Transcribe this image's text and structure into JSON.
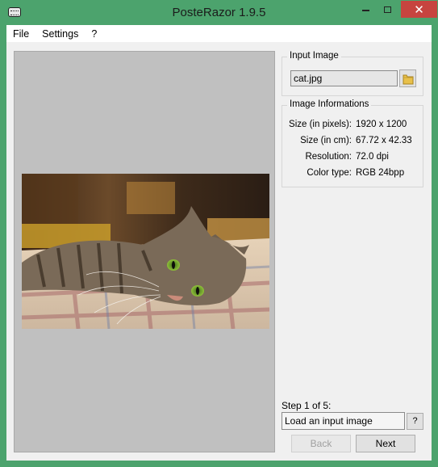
{
  "window": {
    "title": "PosteRazor 1.9.5",
    "close_glyph": "✕",
    "accent_color": "#4ca36d",
    "close_color": "#c7443f"
  },
  "menu": {
    "items": [
      {
        "label": "File"
      },
      {
        "label": "Settings"
      },
      {
        "label": "?"
      }
    ]
  },
  "preview": {
    "image_subject": "cat-photo",
    "background_color": "#c0c0c0"
  },
  "input_image": {
    "group_title": "Input Image",
    "filename": "cat.jpg",
    "browse_icon": "folder-icon"
  },
  "image_info": {
    "group_title": "Image Informations",
    "rows": [
      {
        "label": "Size (in pixels):",
        "value": "1920 x 1200"
      },
      {
        "label": "Size (in cm):",
        "value": "67.72 x 42.33"
      },
      {
        "label": "Resolution:",
        "value": "72.0 dpi"
      },
      {
        "label": "Color type:",
        "value": "RGB 24bpp"
      }
    ]
  },
  "wizard": {
    "step_label": "Step 1 of 5:",
    "step_description": "Load an input image",
    "help_label": "?",
    "back_label": "Back",
    "next_label": "Next"
  }
}
